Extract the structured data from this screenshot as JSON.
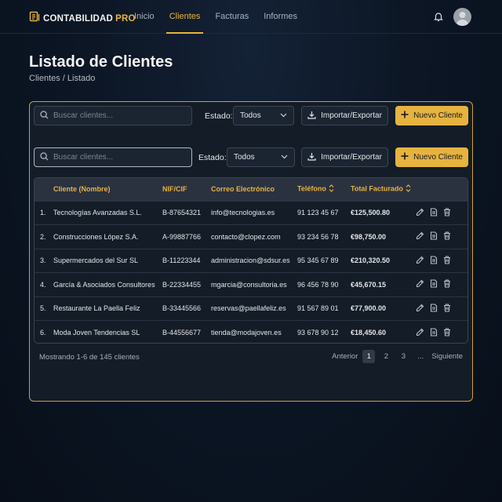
{
  "brand": {
    "name": "CONTABILIDAD",
    "accent": "PRO"
  },
  "nav": [
    {
      "label": "Inicio",
      "active": false
    },
    {
      "label": "Clientes",
      "active": true
    },
    {
      "label": "Facturas",
      "active": false
    },
    {
      "label": "Informes",
      "active": false
    }
  ],
  "page": {
    "title": "Listado de Clientes",
    "breadcrumb": "Clientes / Listado"
  },
  "toolbar": {
    "search_placeholder": "Buscar clientes...",
    "estado_label": "Estado:",
    "estado_value": "Todos",
    "import_export_label": "Importar/Exportar",
    "new_client_label": "Nuevo Cliente"
  },
  "table": {
    "headers": {
      "name": "Cliente (Nombre)",
      "nif": "NIF/CIF",
      "email": "Correo Electrónico",
      "phone": "Teléfono",
      "total": "Total Facturado"
    },
    "rows": [
      {
        "n": "1.",
        "name": "Tecnologías Avanzadas S.L.",
        "nif": "B-87654321",
        "email": "info@tecnologias.es",
        "phone": "91 123 45 67",
        "total": "€125,500.80"
      },
      {
        "n": "2.",
        "name": "Construcciones López S.A.",
        "nif": "A-99887766",
        "email": "contacto@clopez.com",
        "phone": "93 234 56 78",
        "total": "€98,750.00"
      },
      {
        "n": "3.",
        "name": "Supermercados del Sur SL",
        "nif": "B-11223344",
        "email": "administracion@sdsur.es",
        "phone": "95 345 67 89",
        "total": "€210,320.50"
      },
      {
        "n": "4.",
        "name": "García & Asociados Consultores",
        "nif": "B-22334455",
        "email": "mgarcia@consultoria.es",
        "phone": "96 456 78 90",
        "total": "€45,670.15"
      },
      {
        "n": "5.",
        "name": "Restaurante La Paella Feliz",
        "nif": "B-33445566",
        "email": "reservas@paellafeliz.es",
        "phone": "91 567 89 01",
        "total": "€77,900.00"
      },
      {
        "n": "6.",
        "name": "Moda Joven Tendencias SL",
        "nif": "B-44556677",
        "email": "tienda@modajoven.es",
        "phone": "93 678 90 12",
        "total": "€18,450.60"
      }
    ]
  },
  "footer": {
    "showing": "Mostrando 1-6 de 145 clientes",
    "prev": "Anterior",
    "pages": [
      "1",
      "2",
      "3",
      "..."
    ],
    "next": "Siguiente"
  },
  "colors": {
    "accent": "#e6b340",
    "background": "#0c1625",
    "card": "#141c27"
  },
  "icons": [
    "logo-icon",
    "bell-icon",
    "avatar",
    "search-icon",
    "chevron-down-icon",
    "download-icon",
    "plus-icon",
    "sort-icon",
    "edit-icon",
    "document-icon",
    "trash-icon"
  ]
}
